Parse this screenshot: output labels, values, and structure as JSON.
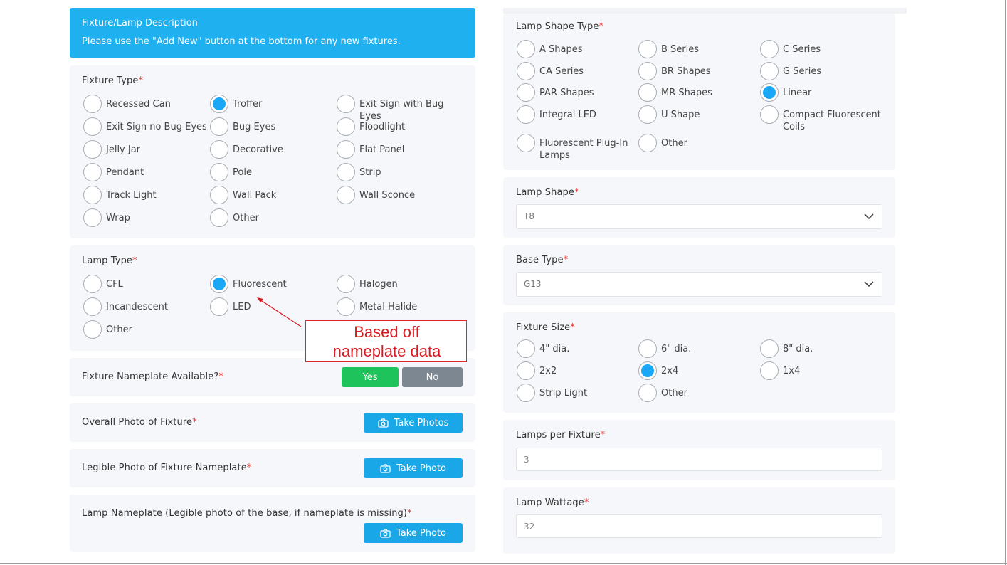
{
  "header": {
    "title": "Fixture/Lamp Description",
    "subtitle": "Please use the \"Add New\" button at the bottom for any new fixtures."
  },
  "required_mark": "*",
  "fixture_type": {
    "label": "Fixture Type",
    "options": [
      "Recessed Can",
      "Troffer",
      "Exit Sign with Bug Eyes",
      "Exit Sign no Bug Eyes",
      "Bug Eyes",
      "Floodlight",
      "Jelly Jar",
      "Decorative",
      "Flat Panel",
      "Pendant",
      "Pole",
      "Strip",
      "Track Light",
      "Wall Pack",
      "Wall Sconce",
      "Wrap",
      "Other"
    ],
    "selected": "Troffer"
  },
  "lamp_type": {
    "label": "Lamp Type",
    "options": [
      "CFL",
      "Fluorescent",
      "Halogen",
      "Incandescent",
      "LED",
      "Metal Halide",
      "Other"
    ],
    "selected": "Fluorescent"
  },
  "annotation": {
    "line1": "Based off",
    "line2": "nameplate data",
    "color": "#d81b22"
  },
  "nameplate_available": {
    "label": "Fixture Nameplate Available?",
    "yes_label": "Yes",
    "no_label": "No"
  },
  "overall_photo": {
    "label": "Overall Photo of Fixture",
    "button": "Take Photos"
  },
  "nameplate_photo": {
    "label": "Legible Photo of Fixture Nameplate",
    "button": "Take Photo"
  },
  "lamp_nameplate": {
    "label": "Lamp Nameplate (Legible photo of the base, if nameplate is missing)",
    "button": "Take Photo"
  },
  "lamp_shape_type": {
    "label": "Lamp Shape Type",
    "options": [
      "A Shapes",
      "B Series",
      "C Series",
      "CA Series",
      "BR Shapes",
      "G Series",
      "PAR Shapes",
      "MR Shapes",
      "Linear",
      "Integral LED",
      "U Shape",
      "Compact Fluorescent Coils",
      "Fluorescent Plug-In Lamps",
      "Other"
    ],
    "selected": "Linear"
  },
  "lamp_shape": {
    "label": "Lamp Shape",
    "value": "T8"
  },
  "base_type": {
    "label": "Base Type",
    "value": "G13"
  },
  "fixture_size": {
    "label": "Fixture Size",
    "options": [
      "4\" dia.",
      "6\" dia.",
      "8\" dia.",
      "2x2",
      "2x4",
      "1x4",
      "Strip Light",
      "Other"
    ],
    "selected": "2x4"
  },
  "lamps_per_fixture": {
    "label": "Lamps per Fixture",
    "value": "3"
  },
  "lamp_wattage": {
    "label": "Lamp Wattage",
    "value": "32"
  },
  "colors": {
    "accent": "#1aa7f5",
    "yes": "#1fc35c",
    "no": "#7d8792",
    "required": "#e53935"
  },
  "icons": {
    "camera": "camera-icon",
    "chevron": "chevron-down-icon"
  }
}
